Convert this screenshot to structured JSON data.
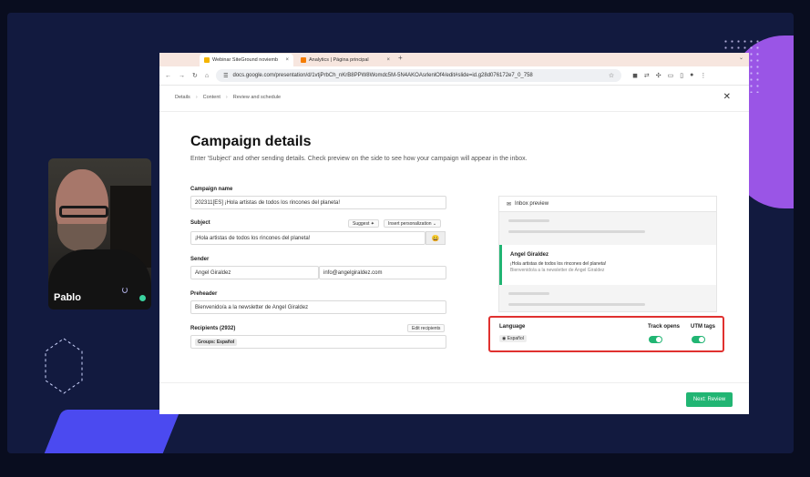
{
  "webcam": {
    "name": "Pablo"
  },
  "browser": {
    "tabs": [
      {
        "label": "Webinar SiteGround noviemb",
        "close": "×"
      },
      {
        "label": "Analytics | Página principal",
        "close": "×"
      }
    ],
    "new_tab": "+",
    "url": "docs.google.com/presentation/d/1vtjPrbCh_nKrB8PPW8Womdc5M-5N4AKOAsrlenlOf4/edit#slide=id.g28d076172e7_0_758"
  },
  "breadcrumb": [
    "Details",
    "Content",
    "Review and schedule"
  ],
  "page": {
    "title": "Campaign details",
    "subtitle": "Enter 'Subject' and other sending details. Check preview on the side to see how your campaign will appear in the inbox."
  },
  "form": {
    "campaign_name_label": "Campaign name",
    "campaign_name_value": "202311[ES] ¡Hola artistas de todos los rincones del planeta!",
    "subject_label": "Subject",
    "suggest_label": "Suggest ✦",
    "personalization_label": "Insert personalization ⌄",
    "subject_value": "¡Hola artistas de todos los rincones del planeta!",
    "emoji": "😀",
    "sender_label": "Sender",
    "sender_name": "Angel Giraldez",
    "sender_email": "info@angelgiraldez.com",
    "preheader_label": "Preheader",
    "preheader_value": "Bienvenido/a a la newsletter de Angel Giraldez",
    "recipients_label": "Recipients (2932)",
    "edit_recipients": "Edit recipients",
    "groups_tag": "Groups: Español"
  },
  "preview": {
    "header": "Inbox preview",
    "from": "Angel Giraldez",
    "subject": "¡Hola artistas de todos los rincones del planeta!",
    "preheader": "Bienvenido/a a la newsletter de Angel Giraldez"
  },
  "settings": {
    "language_label": "Language",
    "language_value": "Español",
    "track_opens_label": "Track opens",
    "track_opens": true,
    "utm_label": "UTM tags",
    "utm": true
  },
  "footer": {
    "next_label": "Next: Review"
  },
  "colors": {
    "accent": "#21b573",
    "highlight": "#e0312f",
    "purple": "#9a55e6"
  }
}
